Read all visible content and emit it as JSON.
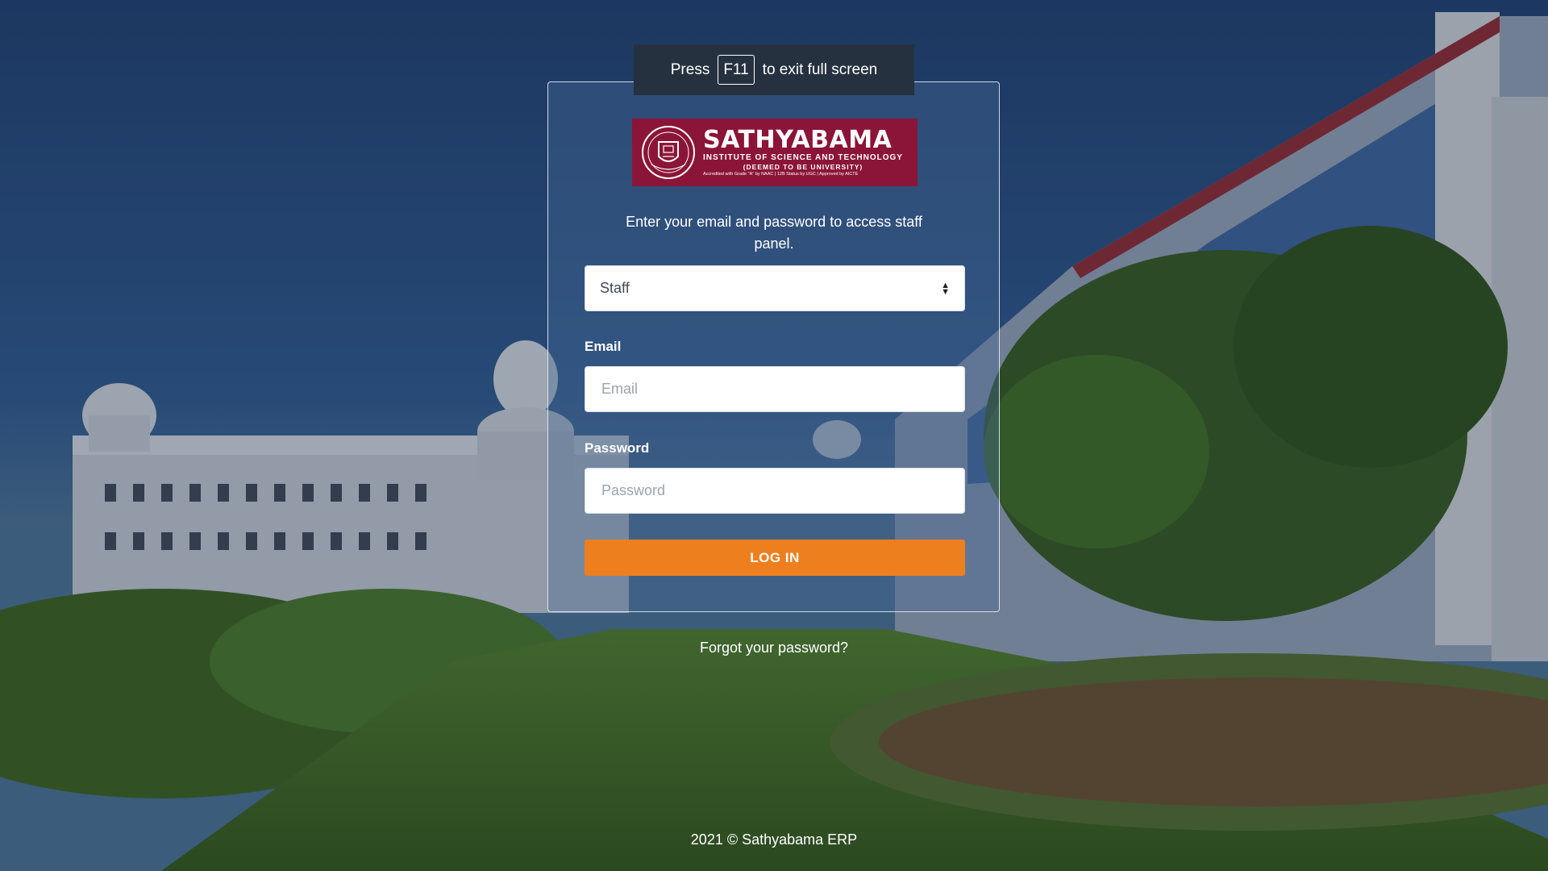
{
  "fullscreen_notice": {
    "prefix": "Press",
    "key": "F11",
    "suffix": "to exit full screen"
  },
  "logo": {
    "name": "SATHYABAMA",
    "subtitle": "INSTITUTE OF SCIENCE AND TECHNOLOGY",
    "subtitle2": "(DEEMED TO BE UNIVERSITY)",
    "accreditation": "Accredited with Grade \"A\" by NAAC | 12B Status by UGC | Approved by AICTE",
    "brand_color": "#8b1538"
  },
  "login": {
    "intro": "Enter your email and password to access staff panel.",
    "role_selected": "Staff",
    "email_label": "Email",
    "email_placeholder": "Email",
    "password_label": "Password",
    "password_placeholder": "Password",
    "submit_label": "LOG IN",
    "accent_color": "#ee7f1f"
  },
  "links": {
    "forgot_password": "Forgot your password?"
  },
  "footer": {
    "text": "2021 © Sathyabama ERP"
  }
}
